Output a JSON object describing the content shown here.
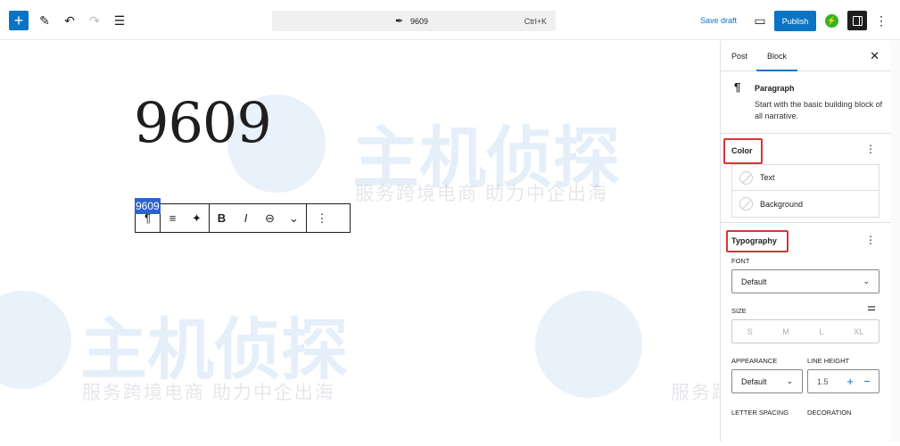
{
  "topbar": {
    "add_label": "+",
    "document_title": "9609",
    "shortcut": "Ctrl+K",
    "save_draft": "Save draft",
    "publish": "Publish",
    "jetpack_label": "⚡"
  },
  "editor": {
    "post_title": "9609",
    "paragraph_text": "9609",
    "toolbar": {
      "paragraph": "¶",
      "align": "≡",
      "ai": "✦",
      "bold": "B",
      "italic": "I",
      "link": "⊖",
      "more": "⌄",
      "options": "⋮"
    }
  },
  "sidebar": {
    "tabs": [
      "Post",
      "Block"
    ],
    "active_tab": "Block",
    "close": "✕",
    "block": {
      "icon": "¶",
      "name": "Paragraph",
      "description": "Start with the basic building block of all narrative."
    },
    "color": {
      "title": "Color",
      "items": [
        "Text",
        "Background"
      ]
    },
    "typography": {
      "title": "Typography",
      "font_label": "FONT",
      "font_value": "Default",
      "size_label": "SIZE",
      "sizes": [
        "S",
        "M",
        "L",
        "XL"
      ],
      "appearance_label": "APPEARANCE",
      "appearance_value": "Default",
      "line_height_label": "LINE HEIGHT",
      "line_height_value": "1.5",
      "letter_spacing_label": "LETTER SPACING",
      "decoration_label": "DECORATION"
    }
  },
  "watermark": {
    "brand": "主机侦探",
    "slogan": "服务跨境电商 助力中企出海"
  },
  "colors": {
    "accent": "#0a74c4",
    "highlight": "#d63638",
    "selection": "#2d63c8"
  }
}
